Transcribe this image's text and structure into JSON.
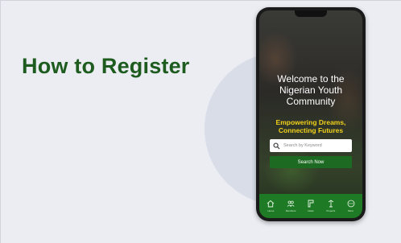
{
  "slide": {
    "heading": "How to Register"
  },
  "app": {
    "welcome_line1": "Welcome to the",
    "welcome_line2": "Nigerian Youth",
    "welcome_line3": "Community",
    "tagline_line1": "Empowering Dreams,",
    "tagline_line2": "Connecting Futures",
    "search": {
      "placeholder": "Search by Keyword",
      "icon": "search-icon"
    },
    "search_button_label": "Search Now",
    "nav": [
      {
        "label": "Home",
        "icon": "home-icon"
      },
      {
        "label": "Members",
        "icon": "members-icon"
      },
      {
        "label": "Ideas",
        "icon": "ideas-icon"
      },
      {
        "label": "Projects",
        "icon": "projects-icon"
      },
      {
        "label": "More",
        "icon": "more-icon"
      }
    ]
  },
  "colors": {
    "heading": "#1d5c1e",
    "tagline": "#f2d21a",
    "nav_bar": "#1e7a24",
    "search_button": "#1d6b22",
    "slide_background": "#ebedf3"
  }
}
